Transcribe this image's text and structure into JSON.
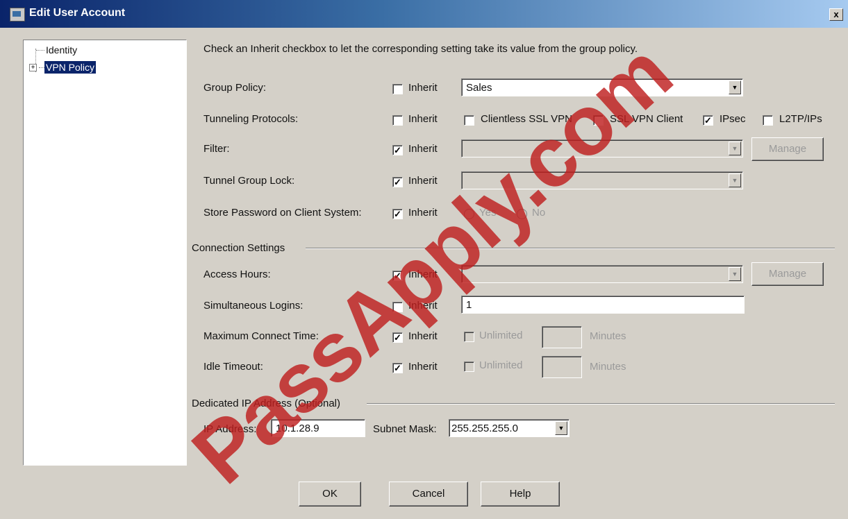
{
  "window": {
    "title": "Edit User Account",
    "close_label": "x"
  },
  "tree": {
    "expander": "+",
    "items": [
      {
        "label": "Identity",
        "selected": false
      },
      {
        "label": "VPN Policy",
        "selected": true
      }
    ]
  },
  "instruction": "Check an Inherit checkbox to let the corresponding setting take its value from the group policy.",
  "inherit_label": "Inherit",
  "check_mark": "✓",
  "combo_arrow": "▼",
  "policy": {
    "group_policy": {
      "label": "Group Policy:",
      "inherit": false,
      "value": "Sales"
    },
    "tunneling": {
      "label": "Tunneling Protocols:",
      "inherit": false,
      "options": [
        {
          "label": "Clientless SSL VPN",
          "checked": false
        },
        {
          "label": "SSL VPN Client",
          "checked": false
        },
        {
          "label": "IPsec",
          "checked": true
        },
        {
          "label": "L2TP/IPs",
          "checked": false
        }
      ]
    },
    "filter": {
      "label": "Filter:",
      "inherit": true,
      "value": "",
      "manage_label": "Manage"
    },
    "tunnel_group_lock": {
      "label": "Tunnel Group Lock:",
      "inherit": true,
      "value": ""
    },
    "store_password": {
      "label": "Store Password on Client System:",
      "inherit": true,
      "yes_label": "Yes",
      "no_label": "No"
    }
  },
  "connection": {
    "section_title": "Connection Settings",
    "access_hours": {
      "label": "Access Hours:",
      "inherit": true,
      "value": "",
      "manage_label": "Manage"
    },
    "simultaneous_logins": {
      "label": "Simultaneous Logins:",
      "inherit": false,
      "value": "1"
    },
    "max_connect_time": {
      "label": "Maximum Connect Time:",
      "inherit": true,
      "unlimited_label": "Unlimited",
      "minutes_label": "Minutes"
    },
    "idle_timeout": {
      "label": "Idle Timeout:",
      "inherit": true,
      "unlimited_label": "Unlimited",
      "minutes_label": "Minutes"
    }
  },
  "dedicated_ip": {
    "section_title": "Dedicated IP Address (Optional)",
    "ip_label": "IP Address:",
    "ip_value": "10.1.28.9",
    "subnet_label": "Subnet Mask:",
    "subnet_value": "255.255.255.0"
  },
  "buttons": {
    "ok": "OK",
    "cancel": "Cancel",
    "help": "Help"
  },
  "watermark": "PassApply.com"
}
